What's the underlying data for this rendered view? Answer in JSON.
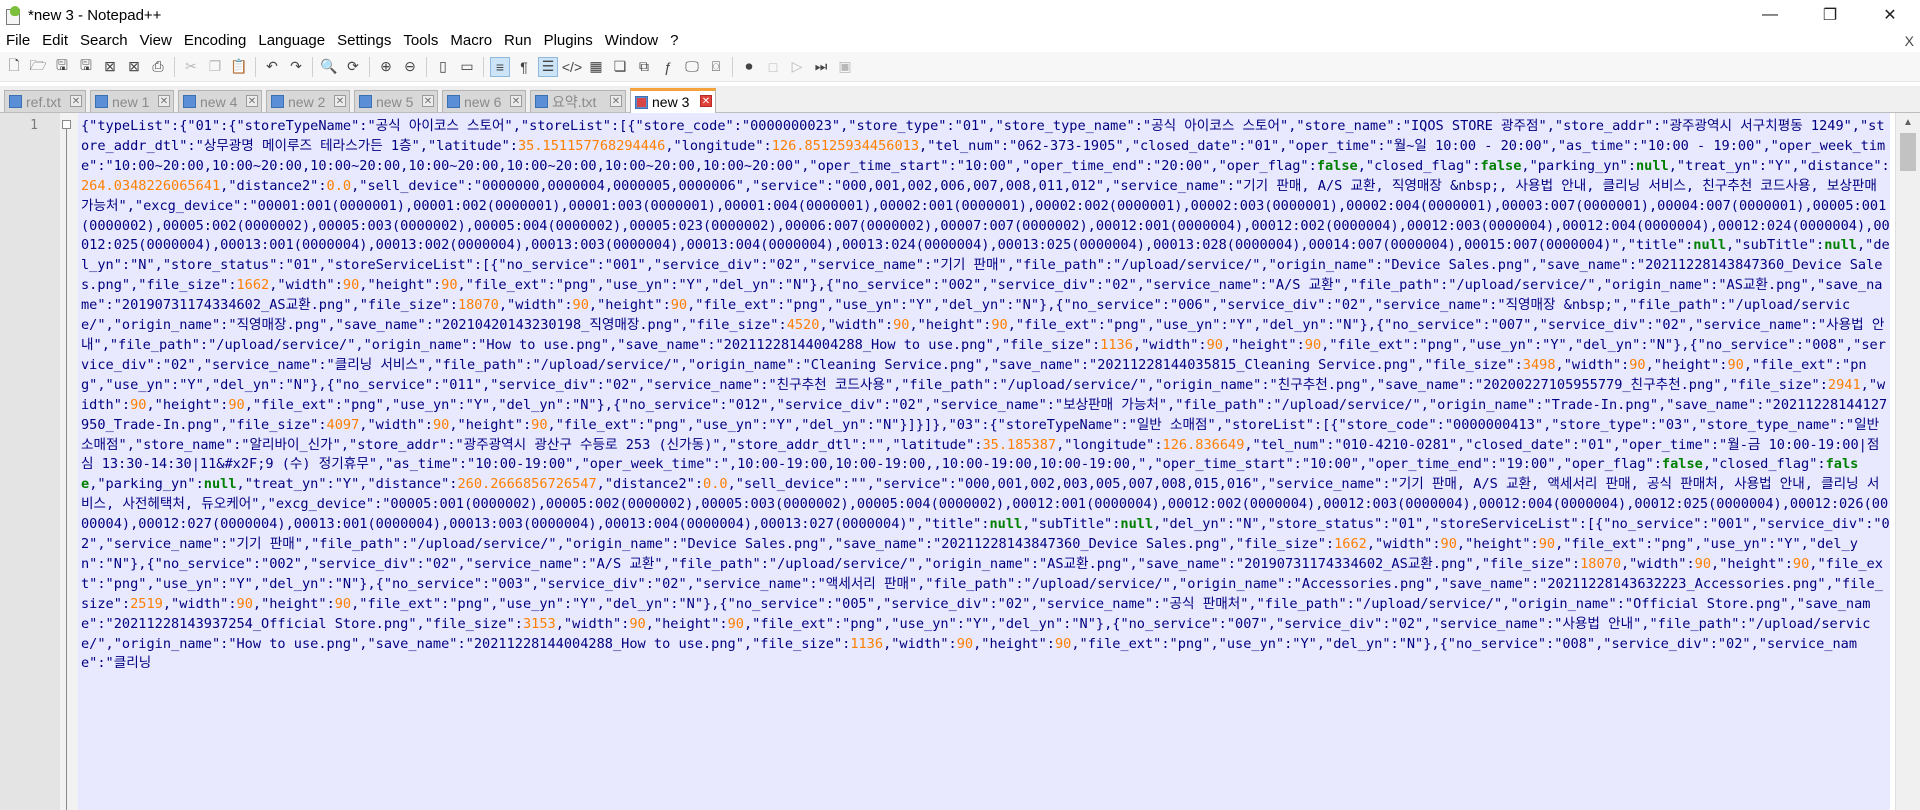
{
  "window": {
    "title": "*new 3 - Notepad++",
    "controls": {
      "minimize": "—",
      "maximize": "❐",
      "close": "✕"
    }
  },
  "menu": [
    "File",
    "Edit",
    "Search",
    "View",
    "Encoding",
    "Language",
    "Settings",
    "Tools",
    "Macro",
    "Run",
    "Plugins",
    "Window",
    "?"
  ],
  "menu_close": "X",
  "tabs": [
    {
      "label": "ref.txt",
      "active": false,
      "saved": true
    },
    {
      "label": "new 1",
      "active": false,
      "saved": true
    },
    {
      "label": "new 4",
      "active": false,
      "saved": true
    },
    {
      "label": "new 2",
      "active": false,
      "saved": true
    },
    {
      "label": "new 5",
      "active": false,
      "saved": true
    },
    {
      "label": "new 6",
      "active": false,
      "saved": true
    },
    {
      "label": "요약.txt",
      "active": false,
      "saved": true
    },
    {
      "label": "new 3",
      "active": true,
      "saved": false
    }
  ],
  "editor": {
    "line_number": "1",
    "content": "{\"typeList\":{\"01\":{\"storeTypeName\":\"공식 아이코스 스토어\",\"storeList\":[{\"store_code\":\"0000000023\",\"store_type\":\"01\",\"store_type_name\":\"공식 아이코스 스토어\",\"store_name\":\"IQOS STORE 광주점\",\"store_addr\":\"광주광역시 서구치평동 1249\",\"store_addr_dtl\":\"상무광명 메이루즈 테라스가든 1층\",\"latitude\":35.151157768294446,\"longitude\":126.85125934456013,\"tel_num\":\"062-373-1905\",\"closed_date\":\"01\",\"oper_time\":\"월~일 10:00 - 20:00\",\"as_time\":\"10:00 - 19:00\",\"oper_week_time\":\"10:00~20:00,10:00~20:00,10:00~20:00,10:00~20:00,10:00~20:00,10:00~20:00,10:00~20:00\",\"oper_time_start\":\"10:00\",\"oper_time_end\":\"20:00\",\"oper_flag\":false,\"closed_flag\":false,\"parking_yn\":null,\"treat_yn\":\"Y\",\"distance\":264.0348226065641,\"distance2\":0.0,\"sell_device\":\"0000000,0000004,0000005,0000006\",\"service\":\"000,001,002,006,007,008,011,012\",\"service_name\":\"기기 판매, A/S 교환, 직영매장 &nbsp;, 사용법 안내, 클리닝 서비스, 친구추천 코드사용, 보상판매 가능처\",\"excg_device\":\"00001:001(0000001),00001:002(0000001),00001:003(0000001),00001:004(0000001),00002:001(0000001),00002:002(0000001),00002:003(0000001),00002:004(0000001),00003:007(0000001),00004:007(0000001),00005:001(0000002),00005:002(0000002),00005:003(0000002),00005:004(0000002),00005:023(0000002),00006:007(0000002),00007:007(0000002),00012:001(0000004),00012:002(0000004),00012:003(0000004),00012:004(0000004),00012:024(0000004),00012:025(0000004),00013:001(0000004),00013:002(0000004),00013:003(0000004),00013:004(0000004),00013:024(0000004),00013:025(0000004),00013:028(0000004),00014:007(0000004),00015:007(0000004)\",\"title\":null,\"subTitle\":null,\"del_yn\":\"N\",\"store_status\":\"01\",\"storeServiceList\":[{\"no_service\":\"001\",\"service_div\":\"02\",\"service_name\":\"기기 판매\",\"file_path\":\"/upload/service/\",\"origin_name\":\"Device Sales.png\",\"save_name\":\"20211228143847360_Device Sales.png\",\"file_size\":1662,\"width\":90,\"height\":90,\"file_ext\":\"png\",\"use_yn\":\"Y\",\"del_yn\":\"N\"},{\"no_service\":\"002\",\"service_div\":\"02\",\"service_name\":\"A/S 교환\",\"file_path\":\"/upload/service/\",\"origin_name\":\"AS교환.png\",\"save_name\":\"20190731174334602_AS교환.png\",\"file_size\":18070,\"width\":90,\"height\":90,\"file_ext\":\"png\",\"use_yn\":\"Y\",\"del_yn\":\"N\"},{\"no_service\":\"006\",\"service_div\":\"02\",\"service_name\":\"직영매장 &nbsp;\",\"file_path\":\"/upload/service/\",\"origin_name\":\"직영매장.png\",\"save_name\":\"20210420143230198_직영매장.png\",\"file_size\":4520,\"width\":90,\"height\":90,\"file_ext\":\"png\",\"use_yn\":\"Y\",\"del_yn\":\"N\"},{\"no_service\":\"007\",\"service_div\":\"02\",\"service_name\":\"사용법 안내\",\"file_path\":\"/upload/service/\",\"origin_name\":\"How to use.png\",\"save_name\":\"20211228144004288_How to use.png\",\"file_size\":1136,\"width\":90,\"height\":90,\"file_ext\":\"png\",\"use_yn\":\"Y\",\"del_yn\":\"N\"},{\"no_service\":\"008\",\"service_div\":\"02\",\"service_name\":\"클리닝 서비스\",\"file_path\":\"/upload/service/\",\"origin_name\":\"Cleaning Service.png\",\"save_name\":\"20211228144035815_Cleaning Service.png\",\"file_size\":3498,\"width\":90,\"height\":90,\"file_ext\":\"png\",\"use_yn\":\"Y\",\"del_yn\":\"N\"},{\"no_service\":\"011\",\"service_div\":\"02\",\"service_name\":\"친구추천 코드사용\",\"file_path\":\"/upload/service/\",\"origin_name\":\"친구추천.png\",\"save_name\":\"20200227105955779_친구추천.png\",\"file_size\":2941,\"width\":90,\"height\":90,\"file_ext\":\"png\",\"use_yn\":\"Y\",\"del_yn\":\"N\"},{\"no_service\":\"012\",\"service_div\":\"02\",\"service_name\":\"보상판매 가능처\",\"file_path\":\"/upload/service/\",\"origin_name\":\"Trade-In.png\",\"save_name\":\"20211228144127950_Trade-In.png\",\"file_size\":4097,\"width\":90,\"height\":90,\"file_ext\":\"png\",\"use_yn\":\"Y\",\"del_yn\":\"N\"}]}]},\"03\":{\"storeTypeName\":\"일반 소매점\",\"storeList\":[{\"store_code\":\"0000000413\",\"store_type\":\"03\",\"store_type_name\":\"일반 소매점\",\"store_name\":\"알리바이_신가\",\"store_addr\":\"광주광역시 광산구 수등로 253 (신가동)\",\"store_addr_dtl\":\"\",\"latitude\":35.185387,\"longitude\":126.836649,\"tel_num\":\"010-4210-0281\",\"closed_date\":\"01\",\"oper_time\":\"월-금 10:00-19:00|점심 13:30-14:30|11&#x2F;9 (수) 정기휴무\",\"as_time\":\"10:00-19:00\",\"oper_week_time\":\",10:00-19:00,10:00-19:00,,10:00-19:00,10:00-19:00,\",\"oper_time_start\":\"10:00\",\"oper_time_end\":\"19:00\",\"oper_flag\":false,\"closed_flag\":false,\"parking_yn\":null,\"treat_yn\":\"Y\",\"distance\":260.2666856726547,\"distance2\":0.0,\"sell_device\":\"\",\"service\":\"000,001,002,003,005,007,008,015,016\",\"service_name\":\"기기 판매, A/S 교환, 액세서리 판매, 공식 판매처, 사용법 안내, 클리닝 서비스, 사전헤택처, 듀오케어\",\"excg_device\":\"00005:001(0000002),00005:002(0000002),00005:003(0000002),00005:004(0000002),00012:001(0000004),00012:002(0000004),00012:003(0000004),00012:004(0000004),00012:025(0000004),00012:026(0000004),00012:027(0000004),00013:001(0000004),00013:003(0000004),00013:004(0000004),00013:027(0000004)\",\"title\":null,\"subTitle\":null,\"del_yn\":\"N\",\"store_status\":\"01\",\"storeServiceList\":[{\"no_service\":\"001\",\"service_div\":\"02\",\"service_name\":\"기기 판매\",\"file_path\":\"/upload/service/\",\"origin_name\":\"Device Sales.png\",\"save_name\":\"20211228143847360_Device Sales.png\",\"file_size\":1662,\"width\":90,\"height\":90,\"file_ext\":\"png\",\"use_yn\":\"Y\",\"del_yn\":\"N\"},{\"no_service\":\"002\",\"service_div\":\"02\",\"service_name\":\"A/S 교환\",\"file_path\":\"/upload/service/\",\"origin_name\":\"AS교환.png\",\"save_name\":\"20190731174334602_AS교환.png\",\"file_size\":18070,\"width\":90,\"height\":90,\"file_ext\":\"png\",\"use_yn\":\"Y\",\"del_yn\":\"N\"},{\"no_service\":\"003\",\"service_div\":\"02\",\"service_name\":\"액세서리 판매\",\"file_path\":\"/upload/service/\",\"origin_name\":\"Accessories.png\",\"save_name\":\"20211228143632223_Accessories.png\",\"file_size\":2519,\"width\":90,\"height\":90,\"file_ext\":\"png\",\"use_yn\":\"Y\",\"del_yn\":\"N\"},{\"no_service\":\"005\",\"service_div\":\"02\",\"service_name\":\"공식 판매처\",\"file_path\":\"/upload/service/\",\"origin_name\":\"Official Store.png\",\"save_name\":\"20211228143937254_Official Store.png\",\"file_size\":3153,\"width\":90,\"height\":90,\"file_ext\":\"png\",\"use_yn\":\"Y\",\"del_yn\":\"N\"},{\"no_service\":\"007\",\"service_div\":\"02\",\"service_name\":\"사용법 안내\",\"file_path\":\"/upload/service/\",\"origin_name\":\"How to use.png\",\"save_name\":\"20211228144004288_How to use.png\",\"file_size\":1136,\"width\":90,\"height\":90,\"file_ext\":\"png\",\"use_yn\":\"Y\",\"del_yn\":\"N\"},{\"no_service\":\"008\",\"service_div\":\"02\",\"service_name\":\"클리닝"
  },
  "toolbar_icons": [
    "new-file-icon",
    "open-file-icon",
    "save-icon",
    "save-all-icon",
    "close-icon",
    "close-all-icon",
    "print-icon",
    "cut-icon",
    "copy-icon",
    "paste-icon",
    "undo-icon",
    "redo-icon",
    "find-icon",
    "replace-icon",
    "zoom-in-icon",
    "zoom-out-icon",
    "sync-vertical-icon",
    "sync-horizontal-icon",
    "word-wrap-icon",
    "show-all-chars-icon",
    "indent-guide-icon",
    "xml-tag-icon",
    "document-map-icon",
    "function-list-icon",
    "folder-workspace-icon",
    "fx-icon",
    "monitor-icon",
    "screenshot-icon",
    "record-macro-icon",
    "stop-macro-icon",
    "play-macro-icon",
    "run-macro-multiple-icon",
    "save-macro-icon"
  ],
  "colors": {
    "keyword": "#000080",
    "number": "#ff8000",
    "literal": "#008000",
    "code_bg": "#e8e8ff",
    "active_tab_accent": "#f5a13c"
  }
}
